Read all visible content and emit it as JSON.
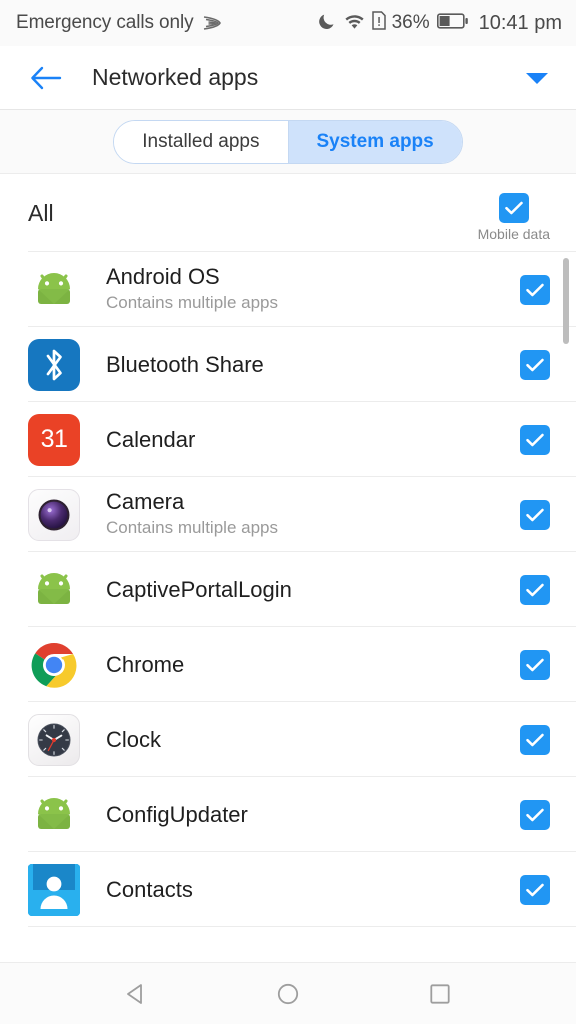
{
  "status_bar": {
    "carrier_text": "Emergency calls only",
    "signal_icon": "signal-arcs-icon",
    "dnd_icon": "moon-icon",
    "wifi_icon": "wifi-icon",
    "sim_alert_icon": "sim-alert-icon",
    "battery_percent": "36%",
    "battery_icon": "battery-icon",
    "battery_level": 40,
    "time": "10:41 pm"
  },
  "header": {
    "back_icon": "back-arrow-icon",
    "title": "Networked apps",
    "dropdown_icon": "chevron-down-icon"
  },
  "tabs": {
    "items": [
      {
        "label": "Installed apps",
        "active": false
      },
      {
        "label": "System apps",
        "active": true
      }
    ],
    "active_color": "#1a82f7",
    "active_bg": "#cfe2fb",
    "border_color": "#c4d8f2"
  },
  "all_row": {
    "label": "All",
    "column_label": "Mobile data",
    "checked": true
  },
  "apps": [
    {
      "name": "Android OS",
      "subtitle": "Contains multiple apps",
      "icon": "android-robot-icon",
      "checked": true
    },
    {
      "name": "Bluetooth Share",
      "subtitle": "",
      "icon": "bluetooth-icon",
      "checked": true
    },
    {
      "name": "Calendar",
      "subtitle": "",
      "icon": "calendar-icon",
      "icon_text": "31",
      "checked": true
    },
    {
      "name": "Camera",
      "subtitle": "Contains multiple apps",
      "icon": "camera-icon",
      "checked": true
    },
    {
      "name": "CaptivePortalLogin",
      "subtitle": "",
      "icon": "android-robot-icon",
      "checked": true
    },
    {
      "name": "Chrome",
      "subtitle": "",
      "icon": "chrome-icon",
      "checked": true
    },
    {
      "name": "Clock",
      "subtitle": "",
      "icon": "clock-icon",
      "checked": true
    },
    {
      "name": "ConfigUpdater",
      "subtitle": "",
      "icon": "android-robot-icon",
      "checked": true
    },
    {
      "name": "Contacts",
      "subtitle": "",
      "icon": "contacts-icon",
      "checked": true
    }
  ],
  "colors": {
    "accent": "#2196f3",
    "android_green": "#8bc34a",
    "bluetooth_blue": "#1677c0",
    "calendar_red": "#ea4226",
    "chrome_red": "#e0402f",
    "chrome_green": "#0f9d58",
    "chrome_yellow": "#f7ca2c",
    "chrome_blue": "#4285f4",
    "contacts_blue": "#1a87c9",
    "contacts_blue_light": "#29b0ee",
    "camera_purple": "#4a2a6e"
  },
  "nav_bar": {
    "back_icon": "nav-back-triangle-icon",
    "home_icon": "nav-home-circle-icon",
    "recents_icon": "nav-recents-square-icon"
  }
}
